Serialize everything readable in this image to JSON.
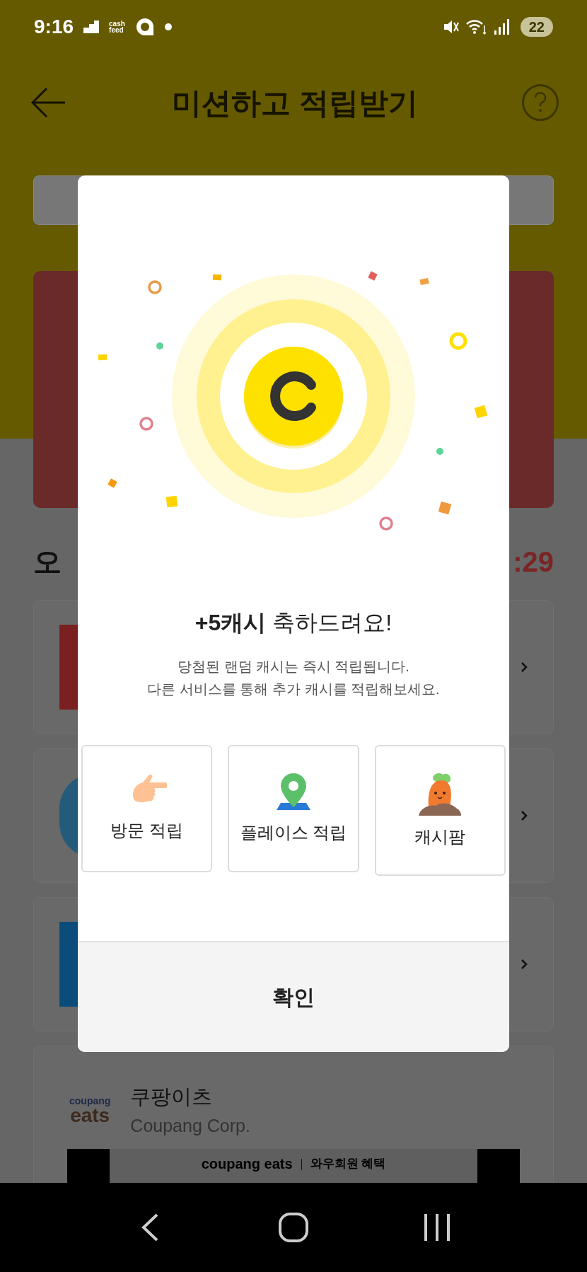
{
  "status_bar": {
    "time": "9:16",
    "app_label": [
      "cash",
      "feed"
    ],
    "battery": "22"
  },
  "header": {
    "title": "미션하고 적립받기"
  },
  "background": {
    "section_title_fragment": "오",
    "timer_fragment": ":29",
    "app_card": {
      "logo": [
        "coupang",
        "eats"
      ],
      "title": "쿠팡이츠",
      "company": "Coupang Corp.",
      "banner_brand": "coupang eats",
      "banner_text": "와우회원 혜택"
    }
  },
  "modal": {
    "headline": "**+5캐시** 축하드려요!",
    "message": [
      "당첨된 랜덤 캐시는 즉시 적립됩니다.",
      "다른 서비스를 통해 추가 캐시를 적립해보세요."
    ],
    "services": [
      {
        "label": "방문 적립",
        "kind": "hand"
      },
      {
        "label": "플레이스 적립",
        "kind": "pin"
      },
      {
        "label": "캐시팜",
        "kind": "carrot"
      }
    ],
    "confirm": "확인"
  }
}
